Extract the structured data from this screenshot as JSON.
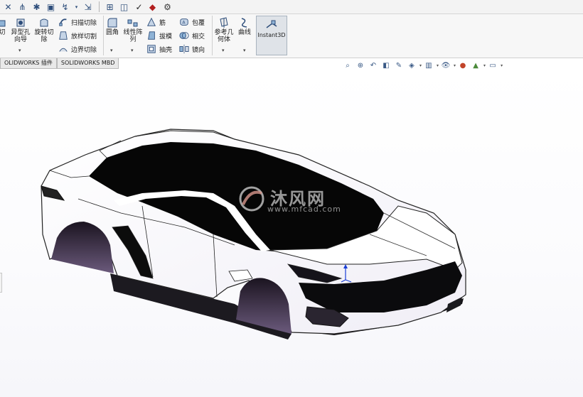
{
  "ribbon": {
    "cut_label": "切",
    "hole_wizard_label": "异型孔\n向导",
    "revolve_cut_label": "旋转切\n除",
    "sweep_cut_label": "扫描切除",
    "loft_cut_label": "放样切割",
    "boundary_cut_label": "边界切除",
    "fillet_label": "圆角",
    "linear_pattern_label": "线性阵\n列",
    "rib_label": "筋",
    "draft_label": "拔模",
    "shell_label": "抽壳",
    "wrap_label": "包覆",
    "intersect_label": "相交",
    "mirror_label": "镜向",
    "reference_geometry_label": "参考几\n何体",
    "curves_label": "曲线",
    "instant3d_label": "Instant3D"
  },
  "tabs": [
    {
      "label": "OLIDWORKS 插件"
    },
    {
      "label": "SOLIDWORKS MBD"
    }
  ],
  "watermark": {
    "brand": "沐风网",
    "url": "www.mfcad.com"
  },
  "colors": {
    "ribbon_bg": "#f7f7f7",
    "selected_button": "#dfe3e8",
    "body_dark": "#0a0a0a",
    "wheel_arch": "#3b2d4a",
    "axis_blue": "#1a3fd6"
  },
  "icons": [
    "smart-dimension-icon",
    "sketch-icon",
    "feature-icon",
    "rebuild-icon",
    "options-icon",
    "zoom-to-fit-icon",
    "zoom-area-icon",
    "previous-view-icon",
    "section-view-icon",
    "view-orientation-icon",
    "display-style-icon",
    "hide-show-icon",
    "appearance-icon",
    "scene-icon",
    "view-settings-icon"
  ]
}
